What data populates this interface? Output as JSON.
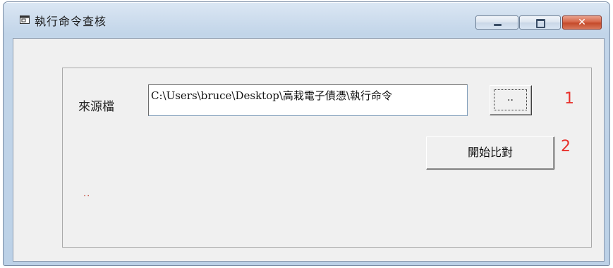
{
  "window": {
    "title": "執行命令查核",
    "icon": "window-app-icon",
    "controls": {
      "minimize": "minimize-icon",
      "maximize": "maximize-icon",
      "close": "close-icon",
      "close_glyph": "✕"
    }
  },
  "form": {
    "source_label": "來源檔",
    "source_path": "C:\\Users\\bruce\\Desktop\\高栽電子債憑\\執行命令",
    "browse_button_label": "..",
    "compare_button_label": "開始比對",
    "status_text": "..",
    "markers": [
      "1",
      "2"
    ]
  },
  "colors": {
    "marker": "#e8302b",
    "status": "#c0392b",
    "close_button": "#c44a2a"
  }
}
